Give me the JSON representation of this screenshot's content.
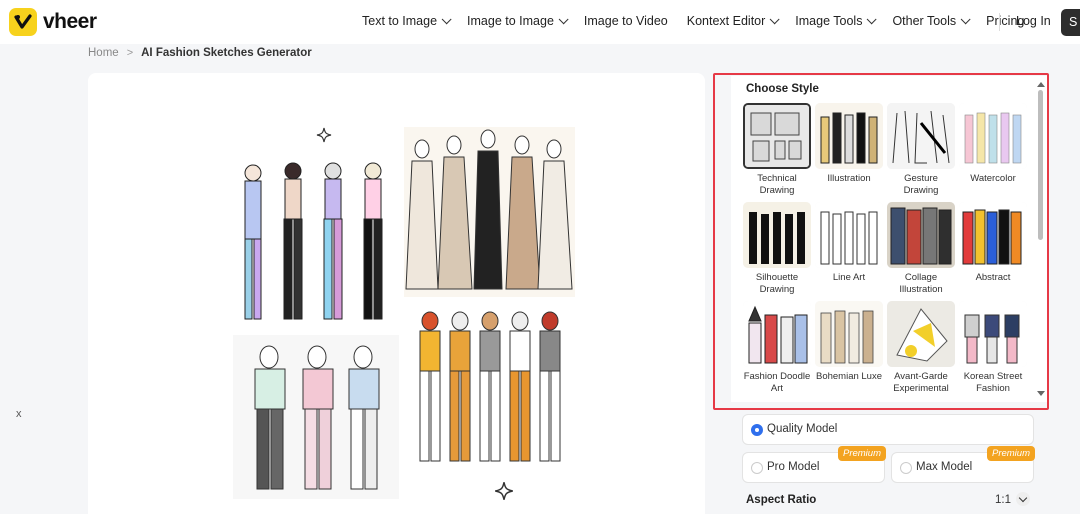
{
  "brand": {
    "name": "vheer"
  },
  "nav": {
    "items": [
      {
        "label": "Text to Image",
        "dropdown": true
      },
      {
        "label": "Image to Image",
        "dropdown": true
      },
      {
        "label": "Image to Video",
        "dropdown": false
      },
      {
        "label": "Kontext Editor",
        "dropdown": true
      },
      {
        "label": "Image Tools",
        "dropdown": true
      },
      {
        "label": "Other Tools",
        "dropdown": true
      },
      {
        "label": "Pricing",
        "dropdown": false
      }
    ],
    "login": "Log In",
    "signup": "S"
  },
  "breadcrumb": {
    "home": "Home",
    "current": "AI Fashion Sketches Generator"
  },
  "side_label": "x",
  "style_panel": {
    "title": "Choose Style",
    "styles": [
      {
        "label": "Technical Drawing",
        "selected": true
      },
      {
        "label": "Illustration",
        "selected": false
      },
      {
        "label": "Gesture Drawing",
        "selected": false
      },
      {
        "label": "Watercolor",
        "selected": false
      },
      {
        "label": "Silhouette Drawing",
        "selected": false
      },
      {
        "label": "Line Art",
        "selected": false
      },
      {
        "label": "Collage Illustration",
        "selected": false
      },
      {
        "label": "Abstract",
        "selected": false
      },
      {
        "label": "Fashion Doodle Art",
        "selected": false
      },
      {
        "label": "Bohemian Luxe",
        "selected": false
      },
      {
        "label": "Avant-Garde Experimental",
        "selected": false
      },
      {
        "label": "Korean Street Fashion",
        "selected": false
      }
    ]
  },
  "models": {
    "quality": "Quality Model",
    "pro": "Pro Model",
    "max": "Max Model",
    "premium_badge": "Premium"
  },
  "aspect_ratio": {
    "label": "Aspect Ratio",
    "value": "1:1"
  },
  "colors": {
    "accent": "#2f6fed",
    "highlight": "#e63946",
    "brand": "#f7d21d",
    "premium": "#f3a320"
  }
}
